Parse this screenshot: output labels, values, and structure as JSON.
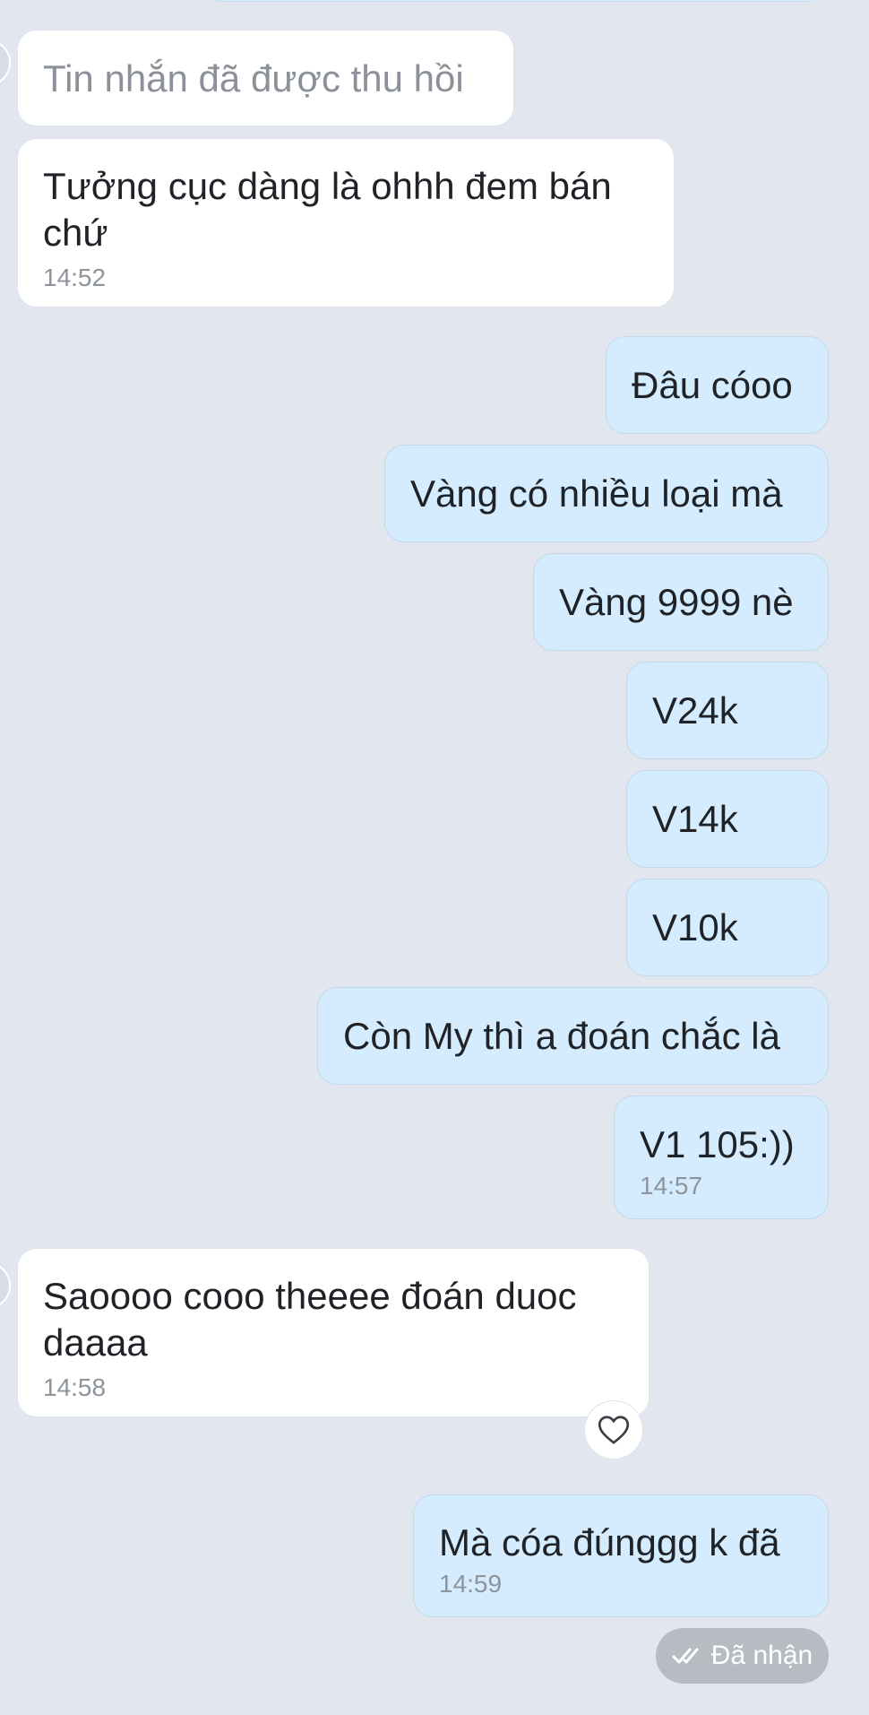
{
  "messages": [
    {
      "id": "m1",
      "text": "Tin nhắn đã được thu hồi"
    },
    {
      "id": "m2",
      "text": "Tưởng cục dàng là ohhh đem bán chứ",
      "time": "14:52"
    },
    {
      "id": "m3",
      "text": "Đâu cóoo"
    },
    {
      "id": "m4",
      "text": "Vàng có nhiều loại mà"
    },
    {
      "id": "m5",
      "text": "Vàng 9999 nè"
    },
    {
      "id": "m6",
      "text": "V24k"
    },
    {
      "id": "m7",
      "text": "V14k"
    },
    {
      "id": "m8",
      "text": "V10k"
    },
    {
      "id": "m9",
      "text": "Còn My thì a đoán chắc là"
    },
    {
      "id": "m10",
      "text": "V1 105:))",
      "time": "14:57"
    },
    {
      "id": "m11",
      "text": "Saoooo cooo theeee đoán duoc daaaa",
      "time": "14:58"
    },
    {
      "id": "m12",
      "text": "Mà cóa đúnggg k đã",
      "time": "14:59"
    }
  ],
  "reaction": {
    "icon": "heart-icon"
  },
  "status": {
    "label": "Đã nhận",
    "icon": "double-check-icon"
  },
  "colors": {
    "background": "#e2e7ef",
    "incoming_bubble": "#ffffff",
    "outgoing_bubble": "#d4ecfd",
    "timestamp": "#8d949c",
    "status_badge": "#b7bcc3"
  }
}
